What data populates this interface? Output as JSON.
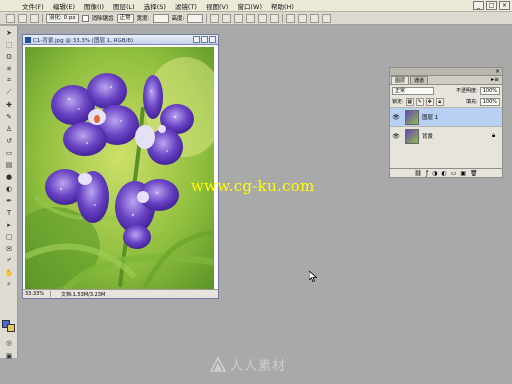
{
  "menu": [
    "文件(F)",
    "编辑(E)",
    "图像(I)",
    "图层(L)",
    "选择(S)",
    "滤镜(T)",
    "视图(V)",
    "窗口(W)",
    "帮助(H)"
  ],
  "options_bar": {
    "sel1": "羽化: 0 px",
    "check_label": "消除锯齿",
    "sel2": "正常",
    "lbl": "宽度:",
    "lbl2": "高度:"
  },
  "document": {
    "title": "C1-背景.jpg @ 33.3% (图层 1, RGB/8)",
    "zoom": "33.33%",
    "status": "文档:1.53M/3.23M"
  },
  "layers_panel": {
    "tabs": [
      "图层",
      "通道"
    ],
    "menu_icon": "panel-menu-icon",
    "blend_mode": "正常",
    "opacity_label": "不透明度:",
    "opacity_value": "100%",
    "lock_label": "锁定:",
    "fill_label": "填充:",
    "fill_value": "100%",
    "layers": [
      {
        "name": "图层 1",
        "active": true,
        "locked": false
      },
      {
        "name": "背景",
        "active": false,
        "locked": true
      }
    ]
  },
  "watermark": {
    "url": "www.cg-ku.com",
    "bottom_text": "人人素材"
  },
  "colors": {
    "foreground": "#4a6ad8",
    "background": "#e8c85a",
    "selected_layer": "#b7d0f3"
  }
}
